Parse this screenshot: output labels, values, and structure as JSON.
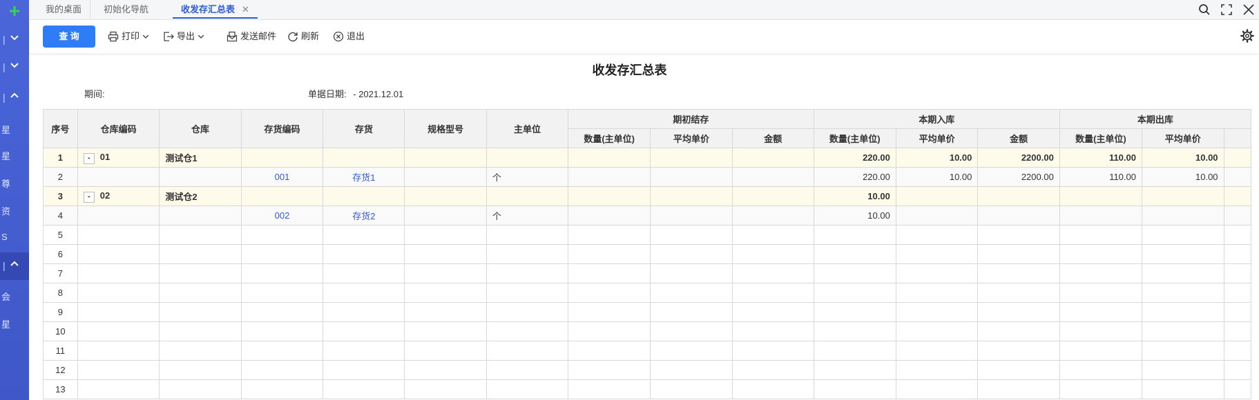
{
  "sidebar": {
    "plus_icon": "+",
    "rows": [
      {
        "bar": "|",
        "chevron": "down"
      },
      {
        "bar": "|",
        "chevron": "down"
      },
      {
        "bar": "|",
        "chevron": "up"
      },
      {
        "bar": "|",
        "chevron": "up"
      }
    ],
    "chars": [
      "星",
      "星",
      "尊",
      "资",
      "S",
      "会",
      "星"
    ]
  },
  "tabs": [
    {
      "label": "我的桌面"
    },
    {
      "label": "初始化导航"
    },
    {
      "label": "收发存汇总表",
      "close": "✕"
    }
  ],
  "toolbar": {
    "query": "查 询",
    "print": "打印",
    "export": "导出",
    "send_mail": "发送邮件",
    "refresh": "刷新",
    "exit": "退出"
  },
  "report": {
    "title": "收发存汇总表",
    "period_label": "期间:",
    "date_label": "单据日期:",
    "date_value": "- 2021.12.01"
  },
  "table": {
    "headers": {
      "seq": "序号",
      "warehouse_code": "仓库编码",
      "warehouse": "仓库",
      "item_code": "存货编码",
      "item": "存货",
      "spec": "规格型号",
      "unit": "主单位",
      "opening": "期初结存",
      "inbound": "本期入库",
      "outbound": "本期出库",
      "qty": "数量(主单位)",
      "avg_price": "平均单价",
      "amount": "金额"
    },
    "rows": [
      {
        "seq": "1",
        "type": "group",
        "toggle": "-",
        "wh_code": "01",
        "wh": "测试仓1",
        "in_qty": "220.00",
        "in_price": "10.00",
        "in_amount": "2200.00",
        "out_qty": "110.00",
        "out_price": "10.00"
      },
      {
        "seq": "2",
        "type": "detail",
        "item_code": "001",
        "item": "存货1",
        "unit": "个",
        "in_qty": "220.00",
        "in_price": "10.00",
        "in_amount": "2200.00",
        "out_qty": "110.00",
        "out_price": "10.00"
      },
      {
        "seq": "3",
        "type": "group",
        "toggle": "-",
        "wh_code": "02",
        "wh": "测试仓2",
        "in_qty": "10.00"
      },
      {
        "seq": "4",
        "type": "detail",
        "item_code": "002",
        "item": "存货2",
        "unit": "个",
        "in_qty": "10.00"
      },
      {
        "seq": "5"
      },
      {
        "seq": "6"
      },
      {
        "seq": "7"
      },
      {
        "seq": "8"
      },
      {
        "seq": "9"
      },
      {
        "seq": "10"
      },
      {
        "seq": "11"
      },
      {
        "seq": "12"
      },
      {
        "seq": "13"
      }
    ]
  }
}
